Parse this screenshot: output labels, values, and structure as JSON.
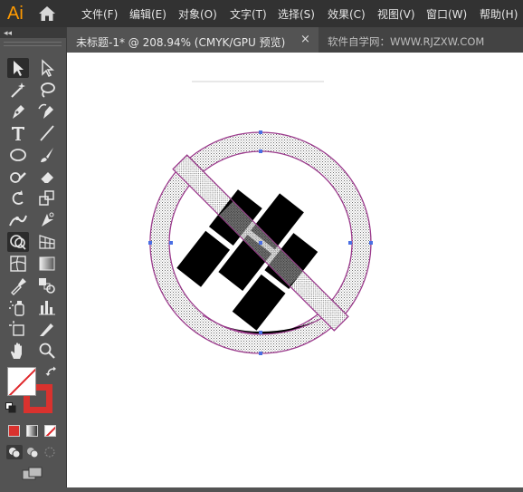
{
  "app": {
    "logo": "Ai"
  },
  "menu": [
    "文件(F)",
    "编辑(E)",
    "对象(O)",
    "文字(T)",
    "选择(S)",
    "效果(C)",
    "视图(V)",
    "窗口(W)",
    "帮助(H)"
  ],
  "document_tab": {
    "label": "未标题-1* @ 208.94% (CMYK/GPU 预览)",
    "close": "×"
  },
  "watermark": "软件自学网：WWW.RJZXW.COM",
  "toolbar": {
    "collapse": "◂◂",
    "tools": [
      "selection-tool",
      "direct-selection-tool",
      "magic-wand-tool",
      "lasso-tool",
      "pen-tool",
      "curvature-tool",
      "type-tool",
      "line-segment-tool",
      "ellipse-tool",
      "paintbrush-tool",
      "shaper-tool",
      "eraser-tool",
      "rotate-tool",
      "scale-tool",
      "width-tool",
      "free-transform-tool",
      "shape-builder-tool",
      "perspective-grid-tool",
      "mesh-tool",
      "gradient-tool",
      "eyedropper-tool",
      "blend-tool",
      "symbol-sprayer-tool",
      "column-graph-tool",
      "artboard-tool",
      "slice-tool",
      "hand-tool",
      "zoom-tool"
    ],
    "active_tool": "shape-builder-tool"
  },
  "colors": {
    "fill": "#ffffff",
    "stroke": "#d9322e",
    "selection": "#4a6fe3",
    "path": "#9b3a8c"
  }
}
